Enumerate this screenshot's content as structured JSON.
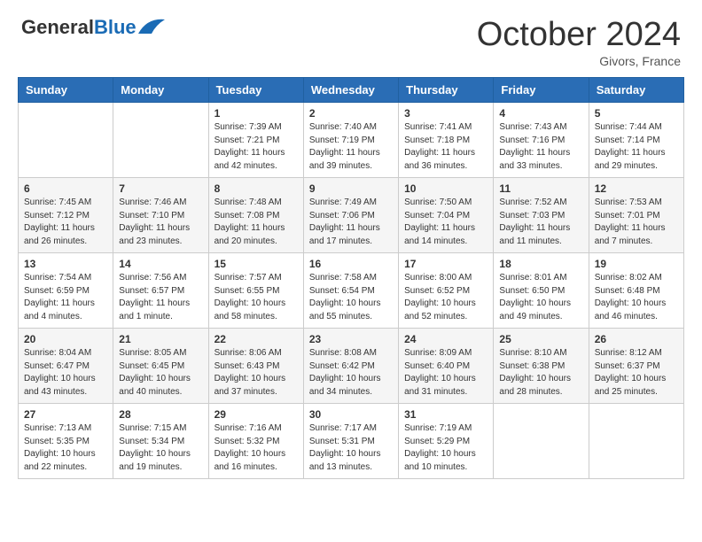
{
  "header": {
    "logo_general": "General",
    "logo_blue": "Blue",
    "month_title": "October 2024",
    "location": "Givors, France"
  },
  "days_of_week": [
    "Sunday",
    "Monday",
    "Tuesday",
    "Wednesday",
    "Thursday",
    "Friday",
    "Saturday"
  ],
  "weeks": [
    [
      {
        "day": "",
        "sunrise": "",
        "sunset": "",
        "daylight": ""
      },
      {
        "day": "",
        "sunrise": "",
        "sunset": "",
        "daylight": ""
      },
      {
        "day": "1",
        "sunrise": "Sunrise: 7:39 AM",
        "sunset": "Sunset: 7:21 PM",
        "daylight": "Daylight: 11 hours and 42 minutes."
      },
      {
        "day": "2",
        "sunrise": "Sunrise: 7:40 AM",
        "sunset": "Sunset: 7:19 PM",
        "daylight": "Daylight: 11 hours and 39 minutes."
      },
      {
        "day": "3",
        "sunrise": "Sunrise: 7:41 AM",
        "sunset": "Sunset: 7:18 PM",
        "daylight": "Daylight: 11 hours and 36 minutes."
      },
      {
        "day": "4",
        "sunrise": "Sunrise: 7:43 AM",
        "sunset": "Sunset: 7:16 PM",
        "daylight": "Daylight: 11 hours and 33 minutes."
      },
      {
        "day": "5",
        "sunrise": "Sunrise: 7:44 AM",
        "sunset": "Sunset: 7:14 PM",
        "daylight": "Daylight: 11 hours and 29 minutes."
      }
    ],
    [
      {
        "day": "6",
        "sunrise": "Sunrise: 7:45 AM",
        "sunset": "Sunset: 7:12 PM",
        "daylight": "Daylight: 11 hours and 26 minutes."
      },
      {
        "day": "7",
        "sunrise": "Sunrise: 7:46 AM",
        "sunset": "Sunset: 7:10 PM",
        "daylight": "Daylight: 11 hours and 23 minutes."
      },
      {
        "day": "8",
        "sunrise": "Sunrise: 7:48 AM",
        "sunset": "Sunset: 7:08 PM",
        "daylight": "Daylight: 11 hours and 20 minutes."
      },
      {
        "day": "9",
        "sunrise": "Sunrise: 7:49 AM",
        "sunset": "Sunset: 7:06 PM",
        "daylight": "Daylight: 11 hours and 17 minutes."
      },
      {
        "day": "10",
        "sunrise": "Sunrise: 7:50 AM",
        "sunset": "Sunset: 7:04 PM",
        "daylight": "Daylight: 11 hours and 14 minutes."
      },
      {
        "day": "11",
        "sunrise": "Sunrise: 7:52 AM",
        "sunset": "Sunset: 7:03 PM",
        "daylight": "Daylight: 11 hours and 11 minutes."
      },
      {
        "day": "12",
        "sunrise": "Sunrise: 7:53 AM",
        "sunset": "Sunset: 7:01 PM",
        "daylight": "Daylight: 11 hours and 7 minutes."
      }
    ],
    [
      {
        "day": "13",
        "sunrise": "Sunrise: 7:54 AM",
        "sunset": "Sunset: 6:59 PM",
        "daylight": "Daylight: 11 hours and 4 minutes."
      },
      {
        "day": "14",
        "sunrise": "Sunrise: 7:56 AM",
        "sunset": "Sunset: 6:57 PM",
        "daylight": "Daylight: 11 hours and 1 minute."
      },
      {
        "day": "15",
        "sunrise": "Sunrise: 7:57 AM",
        "sunset": "Sunset: 6:55 PM",
        "daylight": "Daylight: 10 hours and 58 minutes."
      },
      {
        "day": "16",
        "sunrise": "Sunrise: 7:58 AM",
        "sunset": "Sunset: 6:54 PM",
        "daylight": "Daylight: 10 hours and 55 minutes."
      },
      {
        "day": "17",
        "sunrise": "Sunrise: 8:00 AM",
        "sunset": "Sunset: 6:52 PM",
        "daylight": "Daylight: 10 hours and 52 minutes."
      },
      {
        "day": "18",
        "sunrise": "Sunrise: 8:01 AM",
        "sunset": "Sunset: 6:50 PM",
        "daylight": "Daylight: 10 hours and 49 minutes."
      },
      {
        "day": "19",
        "sunrise": "Sunrise: 8:02 AM",
        "sunset": "Sunset: 6:48 PM",
        "daylight": "Daylight: 10 hours and 46 minutes."
      }
    ],
    [
      {
        "day": "20",
        "sunrise": "Sunrise: 8:04 AM",
        "sunset": "Sunset: 6:47 PM",
        "daylight": "Daylight: 10 hours and 43 minutes."
      },
      {
        "day": "21",
        "sunrise": "Sunrise: 8:05 AM",
        "sunset": "Sunset: 6:45 PM",
        "daylight": "Daylight: 10 hours and 40 minutes."
      },
      {
        "day": "22",
        "sunrise": "Sunrise: 8:06 AM",
        "sunset": "Sunset: 6:43 PM",
        "daylight": "Daylight: 10 hours and 37 minutes."
      },
      {
        "day": "23",
        "sunrise": "Sunrise: 8:08 AM",
        "sunset": "Sunset: 6:42 PM",
        "daylight": "Daylight: 10 hours and 34 minutes."
      },
      {
        "day": "24",
        "sunrise": "Sunrise: 8:09 AM",
        "sunset": "Sunset: 6:40 PM",
        "daylight": "Daylight: 10 hours and 31 minutes."
      },
      {
        "day": "25",
        "sunrise": "Sunrise: 8:10 AM",
        "sunset": "Sunset: 6:38 PM",
        "daylight": "Daylight: 10 hours and 28 minutes."
      },
      {
        "day": "26",
        "sunrise": "Sunrise: 8:12 AM",
        "sunset": "Sunset: 6:37 PM",
        "daylight": "Daylight: 10 hours and 25 minutes."
      }
    ],
    [
      {
        "day": "27",
        "sunrise": "Sunrise: 7:13 AM",
        "sunset": "Sunset: 5:35 PM",
        "daylight": "Daylight: 10 hours and 22 minutes."
      },
      {
        "day": "28",
        "sunrise": "Sunrise: 7:15 AM",
        "sunset": "Sunset: 5:34 PM",
        "daylight": "Daylight: 10 hours and 19 minutes."
      },
      {
        "day": "29",
        "sunrise": "Sunrise: 7:16 AM",
        "sunset": "Sunset: 5:32 PM",
        "daylight": "Daylight: 10 hours and 16 minutes."
      },
      {
        "day": "30",
        "sunrise": "Sunrise: 7:17 AM",
        "sunset": "Sunset: 5:31 PM",
        "daylight": "Daylight: 10 hours and 13 minutes."
      },
      {
        "day": "31",
        "sunrise": "Sunrise: 7:19 AM",
        "sunset": "Sunset: 5:29 PM",
        "daylight": "Daylight: 10 hours and 10 minutes."
      },
      {
        "day": "",
        "sunrise": "",
        "sunset": "",
        "daylight": ""
      },
      {
        "day": "",
        "sunrise": "",
        "sunset": "",
        "daylight": ""
      }
    ]
  ]
}
